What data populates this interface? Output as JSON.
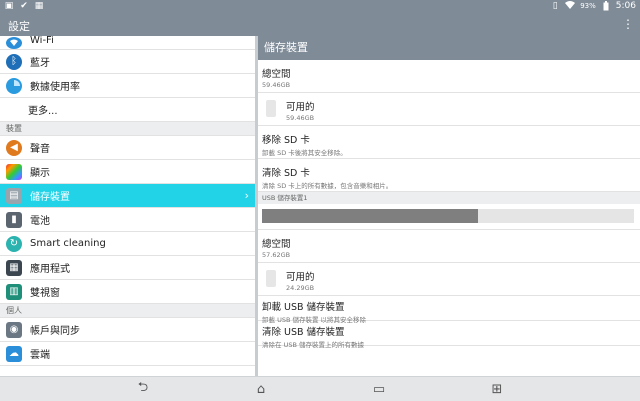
{
  "statusbar": {
    "left_icons": [
      "image-icon",
      "check-icon",
      "photo-icon"
    ],
    "battery": "93%",
    "time": "5:06"
  },
  "actionbar": {
    "title": "設定",
    "menu_glyph": "⋮"
  },
  "left_pane": {
    "row_wifi": "Wi-Fi",
    "row_bluetooth": "藍牙",
    "row_data": "數據使用率",
    "row_more": "更多...",
    "section_device": "裝置",
    "row_sound": "聲音",
    "row_display": "顯示",
    "row_storage": "儲存裝置",
    "row_battery": "電池",
    "row_smart": "Smart cleaning",
    "row_apps": "應用程式",
    "row_dual": "雙視窗",
    "section_personal": "個人",
    "row_accounts": "帳戶與同步",
    "row_cloud": "雲端"
  },
  "right_pane": {
    "header": "儲存裝置",
    "total_space_label": "總空間",
    "total_space_value": "59.46GB",
    "available_label": "可用的",
    "available_value": "59.46GB",
    "unmount_sd_label": "移除 SD 卡",
    "unmount_sd_desc": "卸載 SD 卡後將其安全移除。",
    "erase_sd_label": "清除 SD 卡",
    "erase_sd_desc": "清除 SD 卡上的所有數據，包含音樂和相片。",
    "usb_section": "USB 儲存裝置1",
    "usb_used_fraction": 0.58,
    "usb_total_label": "總空間",
    "usb_total_value": "57.62GB",
    "usb_available_label": "可用的",
    "usb_available_value": "24.29GB",
    "unmount_usb_label": "卸載 USB 儲存裝置",
    "unmount_usb_desc": "卸載 USB 儲存裝置 以將其安全移除",
    "erase_usb_label": "清除 USB 儲存裝置",
    "erase_usb_desc": "清除在 USB 儲存裝置上的所有數據"
  },
  "navbar": {
    "back_glyph": "⮌",
    "home_glyph": "⌂",
    "recents_glyph": "▭",
    "dual_glyph": "⊞"
  },
  "colors": {
    "bar": "#7f8b97",
    "active": "#22d3e8",
    "section_bg": "#eceeef"
  }
}
